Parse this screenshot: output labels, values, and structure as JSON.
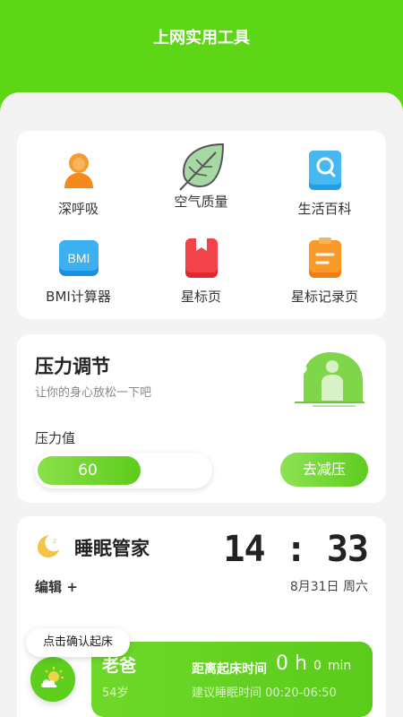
{
  "header": {
    "title": "上网实用工具"
  },
  "tools": [
    {
      "label": "深呼吸",
      "icon": "person-orange-icon"
    },
    {
      "label": "空气质量",
      "icon": "leaf-icon"
    },
    {
      "label": "生活百科",
      "icon": "book-search-icon"
    },
    {
      "label": "BMI计算器",
      "icon": "bmi-icon",
      "icon_text": "BMI"
    },
    {
      "label": "星标页",
      "icon": "bookmark-icon"
    },
    {
      "label": "星标记录页",
      "icon": "clipboard-icon"
    }
  ],
  "stress": {
    "title": "压力调节",
    "subtitle": "让你的身心放松一下吧",
    "value_label": "压力值",
    "value": "60",
    "level_fraction": 0.6,
    "button_label": "去减压"
  },
  "sleep": {
    "title": "睡眠管家",
    "time": "14 : 33",
    "date": "8月31日 周六",
    "edit_label": "编辑 +",
    "tooltip": "点击确认起床",
    "alarm": {
      "name": "老爸",
      "age": "54岁",
      "distance_label": "距离起床时间",
      "hours": "0",
      "hour_unit": "h",
      "minutes": "0",
      "minute_unit": "min",
      "suggest_label": "建议睡眠时间",
      "suggest_range": "00:20-06:50"
    }
  },
  "colors": {
    "brand_green": "#5dd615",
    "bg": "#f3f3f3"
  }
}
